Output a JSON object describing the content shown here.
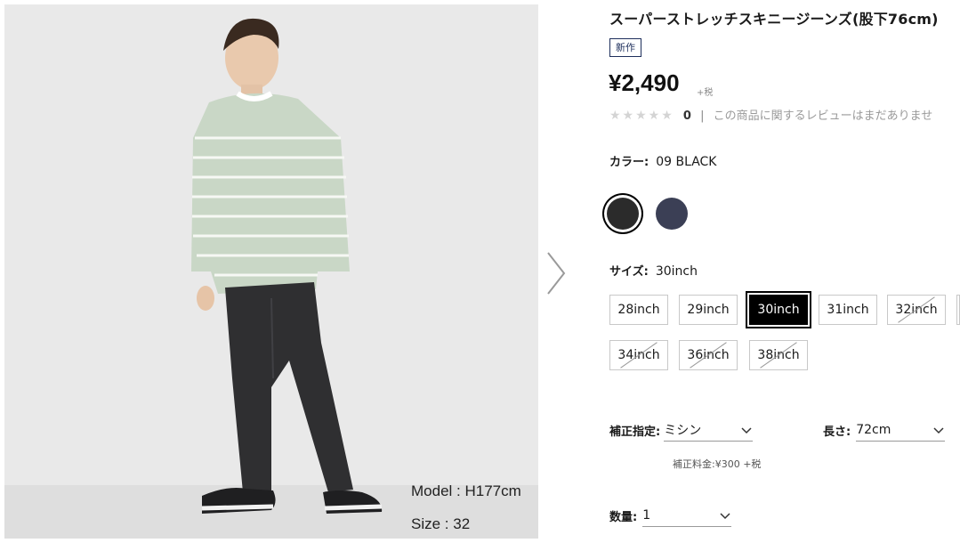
{
  "product": {
    "title": "スーパーストレッチスキニージーンズ(股下76cm)",
    "badge": "新作",
    "price": "¥2,490",
    "tax_note": "+税"
  },
  "rating": {
    "stars": "★★★★★",
    "count": "0",
    "separator": "|",
    "message": "この商品に関するレビューはまだありませ"
  },
  "image": {
    "caption_height": "Model : H177cm",
    "caption_size": "Size : 32",
    "next_icon": "chevron-right-icon"
  },
  "color": {
    "label": "カラー:",
    "value": "09 BLACK",
    "swatches": [
      {
        "name": "black",
        "color": "#2b2b2b",
        "selected": true
      },
      {
        "name": "navy",
        "color": "#3b3f55",
        "selected": false
      }
    ]
  },
  "size": {
    "label": "サイズ:",
    "value": "30inch",
    "options": [
      {
        "label": "28inch",
        "state": "available"
      },
      {
        "label": "29inch",
        "state": "available"
      },
      {
        "label": "30inch",
        "state": "selected"
      },
      {
        "label": "31inch",
        "state": "available"
      },
      {
        "label": "32inch",
        "state": "soldout"
      },
      {
        "label": "34inch",
        "state": "soldout"
      },
      {
        "label": "36inch",
        "state": "soldout"
      },
      {
        "label": "38inch",
        "state": "soldout"
      }
    ]
  },
  "alteration": {
    "label": "補正指定:",
    "value": "ミシン",
    "fee": "補正料金:¥300 +税"
  },
  "length": {
    "label": "長さ:",
    "value": "72cm"
  },
  "quantity": {
    "label": "数量:",
    "value": "1"
  },
  "colors": {
    "accent_navy": "#1e2f5c",
    "selected_size_bg": "#000000",
    "image_bg": "#e9e9e9"
  }
}
